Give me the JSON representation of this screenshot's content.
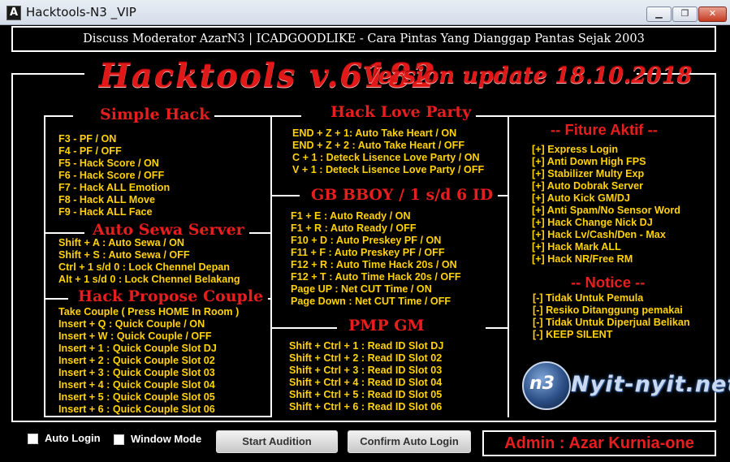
{
  "window": {
    "title": "Hacktools-N3 _VIP",
    "icon": "A",
    "min_label": "▁",
    "max_label": "❐",
    "close_label": "✕"
  },
  "banner": "Discuss Moderator AzarN3 | ICADGOODLIKE - Cara Pintas Yang Dianggap Pantas Sejak 2003",
  "title_main": "Hacktools v.6182",
  "title_version": "Version update 18.10.2018",
  "simple_hack": {
    "title": "Simple Hack",
    "items": [
      "F3 - PF / ON",
      "F4 - PF / OFF",
      "F5 - Hack Score / ON",
      "F6 - Hack Score / OFF",
      "F7 - Hack ALL Emotion",
      "F8 - Hack ALL Move",
      "F9 - Hack ALL Face"
    ]
  },
  "auto_sewa": {
    "title": "Auto Sewa Server",
    "items": [
      "Shift + A : Auto Sewa / ON",
      "Shift + S : Auto Sewa / OFF",
      "Ctrl + 1 s/d 0 : Lock Chennel Depan",
      "Alt + 1 s/d 0 : Lock Chennel Belakang"
    ]
  },
  "hack_propose": {
    "title": "Hack Propose Couple",
    "items": [
      "Take Couple ( Press HOME In Room )",
      "Insert + Q : Quick Couple / ON",
      "Insert + W : Quick Couple / OFF",
      "Insert + 1 : Quick Couple Slot DJ",
      "Insert + 2 : Quick Couple Slot 02",
      "Insert + 3 : Quick Couple Slot 03",
      "Insert + 4 : Quick Couple Slot 04",
      "Insert + 5 : Quick Couple Slot 05",
      "Insert + 6 : Quick Couple Slot 06"
    ]
  },
  "hack_love": {
    "title": "Hack Love Party",
    "items": [
      "END + Z + 1: Auto Take Heart  / ON",
      "END + Z + 2  : Auto Take Heart  / OFF",
      "C + 1 : Deteck Lisence Love Party / ON",
      "V + 1 : Deteck Lisence Love Party / OFF"
    ]
  },
  "gb_bboy": {
    "title": "GB BBOY / 1 s/d 6 ID",
    "items": [
      "F1 + E :  Auto Ready / ON",
      "F1 + R :  Auto Ready / OFF",
      "F10 + D :  Auto Preskey PF / ON",
      "F11 + F :  Auto Preskey PF / OFF",
      "F12 + R : Auto Time Hack 20s / ON",
      "F12 + T : Auto Time Hack 20s / OFF",
      "Page UP : Net CUT Time / ON",
      "Page Down : Net CUT Time / OFF"
    ]
  },
  "pmp_gm": {
    "title": "PMP GM",
    "items": [
      "Shift + Ctrl + 1 : Read ID Slot DJ",
      "Shift + Ctrl + 2 : Read ID Slot 02",
      "Shift + Ctrl + 3 : Read ID Slot 03",
      "Shift + Ctrl + 4 : Read ID Slot 04",
      "Shift + Ctrl + 5 : Read ID Slot 05",
      "Shift + Ctrl + 6 : Read ID Slot 06"
    ]
  },
  "fiture": {
    "title": "-- Fiture Aktif --",
    "items": [
      "[+] Express Login",
      "[+] Anti Down High FPS",
      "[+] Stabilizer Multy Exp",
      "[+] Auto Dobrak Server",
      "[+] Auto Kick GM/DJ",
      "[+] Anti Spam/No Sensor Word",
      "[+] Hack Change Nick DJ",
      "[+] Hack Lv/Cash/Den - Max",
      "[+] Hack Mark ALL",
      "[+] Hack NR/Free RM"
    ]
  },
  "notice": {
    "title": "-- Notice --",
    "items": [
      "[-] Tidak Untuk Pemula",
      "[-] Resiko Ditanggung pemakai",
      "[-] Tidak Untuk Diperjual Belikan",
      "[-] KEEP SILENT"
    ]
  },
  "logo": {
    "mark": "n3",
    "text": "Nyit-nyit.net"
  },
  "footer": {
    "auto_login": "Auto Login",
    "window_mode": "Window Mode",
    "start_button": "Start Audition",
    "confirm_button": "Confirm Auto Login",
    "admin": "Admin : Azar Kurnia-one"
  }
}
